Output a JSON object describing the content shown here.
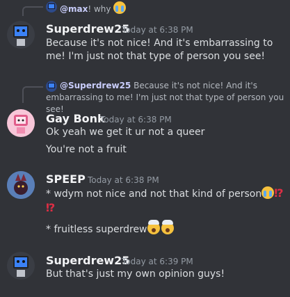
{
  "messages": [
    {
      "reply": {
        "author": "@max",
        "text": "! why"
      },
      "author": "Superdrew25",
      "time": "Today at 6:38 PM",
      "lines": [
        "Because it's not nice! And it's embarrassing to me! I'm just not that type of person you see!"
      ]
    },
    {
      "reply": {
        "author": "@Superdrew25",
        "text": "Because it's not nice! And it's embarrassing to me! I'm just not that type of person you see!"
      },
      "author": "Gay Bonk",
      "time": "Today at 6:38 PM",
      "lines": [
        "Ok yeah we get it ur not a queer",
        "You're not a fruit"
      ]
    },
    {
      "author": "SPEEP",
      "time": "Today at 6:38 PM",
      "lines": [
        "* wdym not nice and not that kind of person",
        "* fruitless superdrew"
      ]
    },
    {
      "author": "Superdrew25",
      "time": "Today at 6:39 PM",
      "lines": [
        "But that's just my own opinion guys!"
      ]
    }
  ],
  "emoji": {
    "interrobang": "⁉"
  },
  "icons": {
    "crying": "loudly-crying-face-icon",
    "shocked": "exploding-head-icon",
    "interrobang": "interrobang-icon"
  },
  "colors": {
    "background": "#313338",
    "username": "#f2f3f5",
    "timestamp": "#949ba4",
    "text": "#dbdee1",
    "interrobang": "#dd2e44"
  }
}
